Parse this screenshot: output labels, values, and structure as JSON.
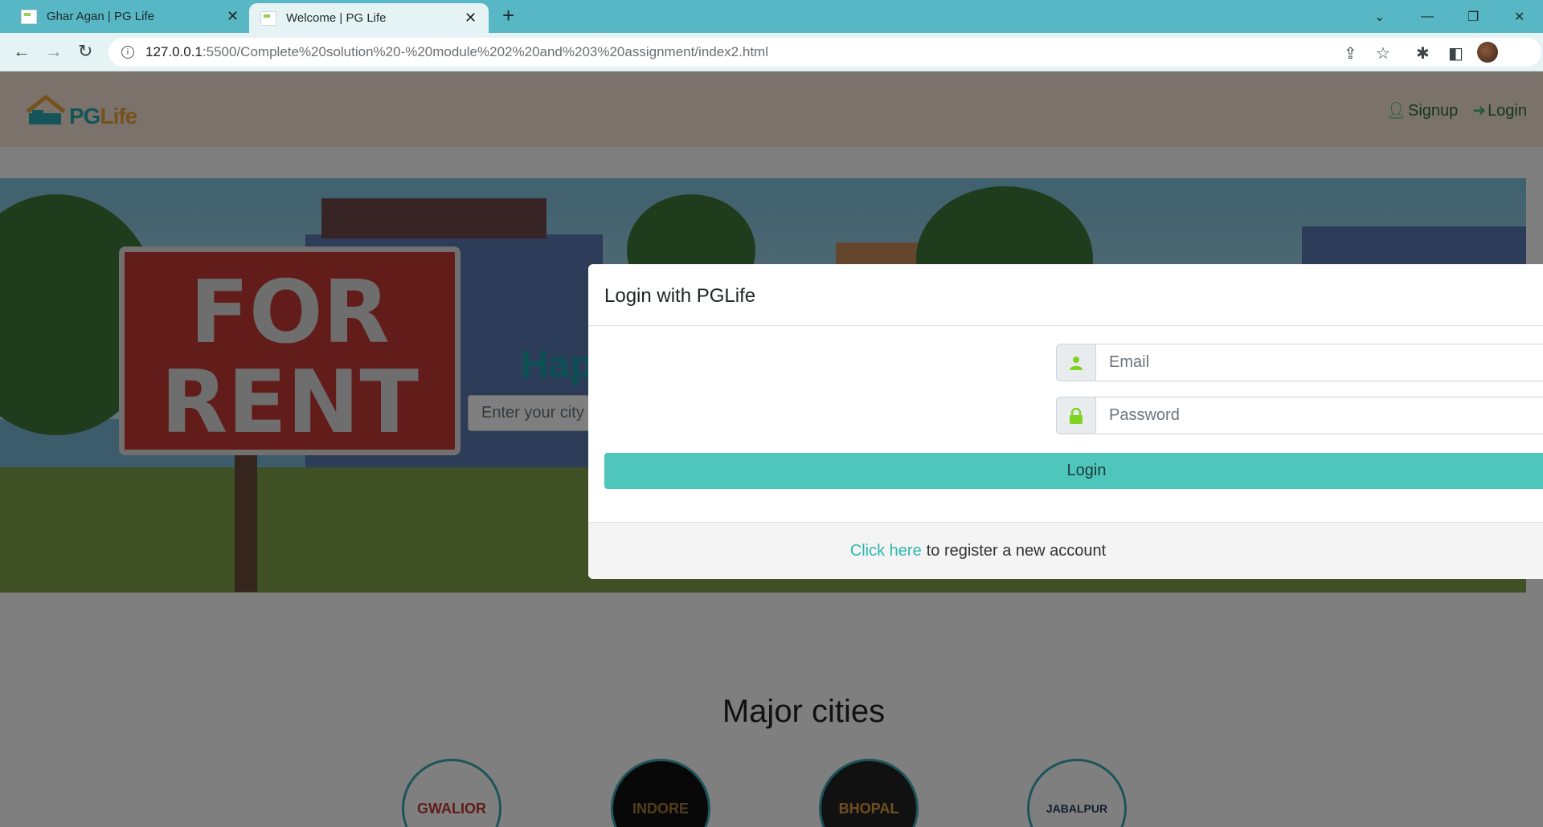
{
  "browser": {
    "tabs": [
      {
        "title": "Ghar Agan | PG Life",
        "active": false
      },
      {
        "title": "Welcome | PG Life",
        "active": true
      }
    ],
    "url_host": "127.0.0.1",
    "url_rest": ":5500/Complete%20solution%20-%20module%202%20and%203%20assignment/index2.html",
    "icons": [
      "back-icon",
      "forward-icon",
      "reload-icon",
      "info-icon",
      "share-icon",
      "star-icon",
      "extensions-icon",
      "sidepanel-icon",
      "avatar-icon"
    ]
  },
  "header": {
    "logo_pg": "PG",
    "logo_life": "Life",
    "signup_label": "Signup",
    "login_label": "Login"
  },
  "banner": {
    "sign_line1": "FOR",
    "sign_line2": "RENT",
    "title_partial": "Hap",
    "city_placeholder": "Enter your city t"
  },
  "cities": {
    "title": "Major cities",
    "items": [
      "GWALIOR",
      "INDORE",
      "BHOPAL",
      "JABALPUR"
    ]
  },
  "modal": {
    "title": "Login with PGLife",
    "email_placeholder": "Email",
    "password_placeholder": "Password",
    "login_button": "Login",
    "footer_link": "Click here",
    "footer_text": "to register a new account"
  },
  "colors": {
    "tabbar": "#57b7c4",
    "accent": "#4ec6bc",
    "icon_green": "#7ed321",
    "header_bg": "#f6e6d7"
  }
}
